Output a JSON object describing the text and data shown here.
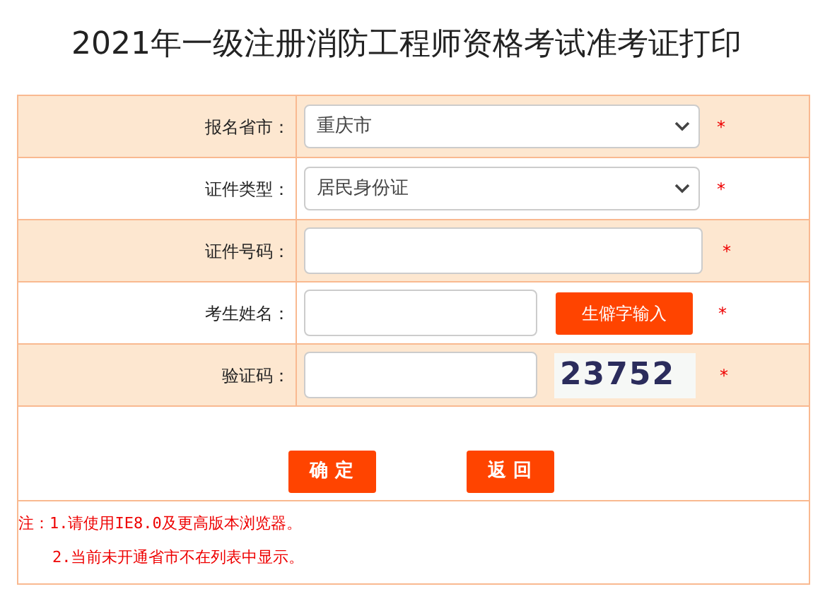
{
  "title": "2021年一级注册消防工程师资格考试准考证打印",
  "fields": [
    {
      "kind": "select",
      "label": "报名省市：",
      "value": "重庆市",
      "required_mark": "*"
    },
    {
      "kind": "select",
      "label": "证件类型：",
      "value": "居民身份证",
      "required_mark": "*"
    },
    {
      "kind": "input",
      "label": "证件号码：",
      "required_mark": "*"
    },
    {
      "kind": "input_button",
      "label": "考生姓名：",
      "button": "生僻字输入",
      "required_mark": "*"
    },
    {
      "kind": "captcha",
      "label": "验证码：",
      "captcha": "23752",
      "required_mark": "*"
    }
  ],
  "buttons": [
    "确 定",
    "返 回"
  ],
  "notes": [
    "注：1.请使用IE8.0及更高版本浏览器。",
    "2.当前未开通省市不在列表中显示。"
  ]
}
